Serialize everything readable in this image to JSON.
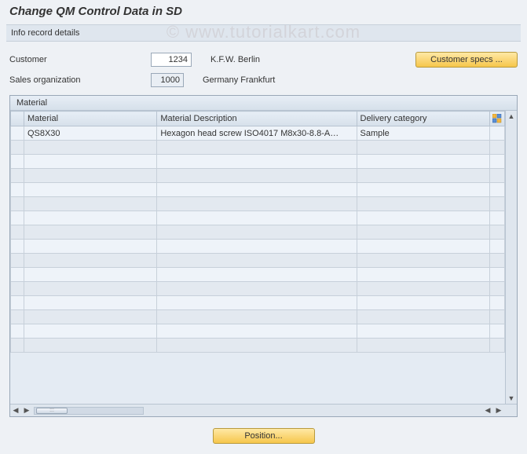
{
  "page": {
    "title": "Change QM Control Data in SD",
    "subtitle": "Info record details"
  },
  "watermark": "© www.tutorialkart.com",
  "form": {
    "customer_label": "Customer",
    "customer_value": "1234",
    "customer_name": "K.F.W. Berlin",
    "sales_org_label": "Sales organization",
    "sales_org_value": "1000",
    "sales_org_name": "Germany Frankfurt",
    "customer_specs_button": "Customer specs ..."
  },
  "panel": {
    "title": "Material",
    "columns": {
      "material": "Material",
      "material_desc": "Material Description",
      "delivery_cat": "Delivery category"
    },
    "rows": [
      {
        "material": "QS8X30",
        "material_desc": "Hexagon head screw ISO4017 M8x30-8.8-A…",
        "delivery_cat": "Sample"
      },
      {
        "material": "",
        "material_desc": "",
        "delivery_cat": ""
      },
      {
        "material": "",
        "material_desc": "",
        "delivery_cat": ""
      },
      {
        "material": "",
        "material_desc": "",
        "delivery_cat": ""
      },
      {
        "material": "",
        "material_desc": "",
        "delivery_cat": ""
      },
      {
        "material": "",
        "material_desc": "",
        "delivery_cat": ""
      },
      {
        "material": "",
        "material_desc": "",
        "delivery_cat": ""
      },
      {
        "material": "",
        "material_desc": "",
        "delivery_cat": ""
      },
      {
        "material": "",
        "material_desc": "",
        "delivery_cat": ""
      },
      {
        "material": "",
        "material_desc": "",
        "delivery_cat": ""
      },
      {
        "material": "",
        "material_desc": "",
        "delivery_cat": ""
      },
      {
        "material": "",
        "material_desc": "",
        "delivery_cat": ""
      },
      {
        "material": "",
        "material_desc": "",
        "delivery_cat": ""
      },
      {
        "material": "",
        "material_desc": "",
        "delivery_cat": ""
      },
      {
        "material": "",
        "material_desc": "",
        "delivery_cat": ""
      },
      {
        "material": "",
        "material_desc": "",
        "delivery_cat": ""
      }
    ]
  },
  "footer": {
    "position_button": "Position..."
  },
  "glyphs": {
    "tri_up": "▲",
    "tri_down": "▼",
    "tri_left": "◀",
    "tri_right": "▶",
    "thumb": ":::"
  }
}
